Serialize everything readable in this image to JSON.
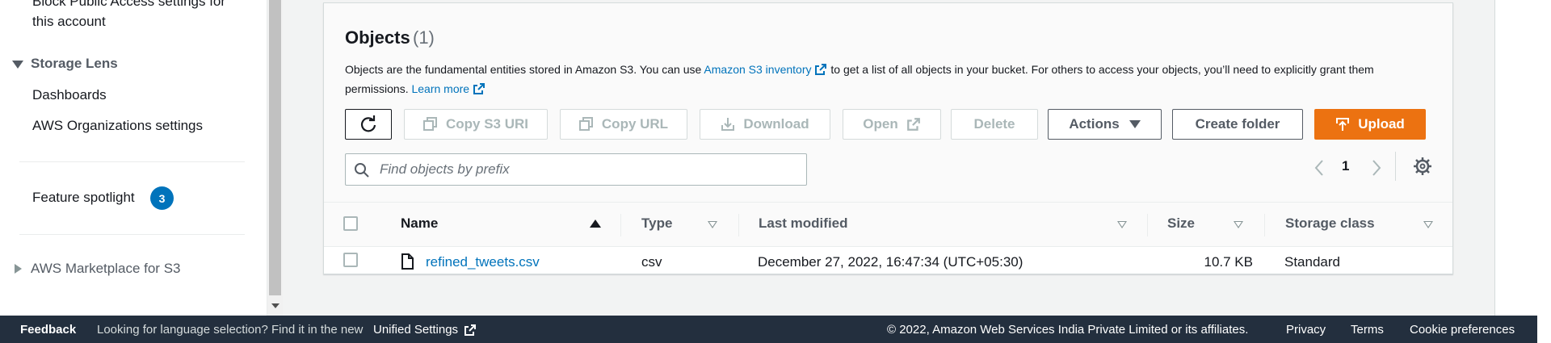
{
  "sidebar": {
    "block_public_access_line1": "Block Public Access settings for",
    "block_public_access_line2": "this account",
    "storage_lens_label": "Storage Lens",
    "dashboards_label": "Dashboards",
    "org_settings_label": "AWS Organizations settings",
    "feature_spotlight_label": "Feature spotlight",
    "feature_spotlight_count": "3",
    "marketplace_label": "AWS Marketplace for S3"
  },
  "objects": {
    "title": "Objects",
    "count": "(1)",
    "desc_part1": "Objects are the fundamental entities stored in Amazon S3. You can use ",
    "inventory_link": "Amazon S3 inventory",
    "desc_part2": " to get a list of all objects in your bucket. For others to access your objects, you’ll need to explicitly grant them permissions. ",
    "learn_more_link": "Learn more"
  },
  "toolbar": {
    "copy_s3_uri": "Copy S3 URI",
    "copy_url": "Copy URL",
    "download": "Download",
    "open": "Open",
    "delete": "Delete",
    "actions": "Actions",
    "create_folder": "Create folder",
    "upload": "Upload"
  },
  "search": {
    "placeholder": "Find objects by prefix",
    "value": ""
  },
  "pagination": {
    "current_page": "1"
  },
  "table": {
    "headers": {
      "name": "Name",
      "type": "Type",
      "last_modified": "Last modified",
      "size": "Size",
      "storage_class": "Storage class"
    },
    "rows": [
      {
        "name": "refined_tweets.csv",
        "type": "csv",
        "last_modified": "December 27, 2022, 16:47:34 (UTC+05:30)",
        "size": "10.7 KB",
        "storage_class": "Standard"
      }
    ]
  },
  "footer": {
    "feedback": "Feedback",
    "language_text": "Looking for language selection? Find it in the new ",
    "unified_settings": "Unified Settings",
    "copyright": "© 2022, Amazon Web Services India Private Limited or its affiliates.",
    "privacy": "Privacy",
    "terms": "Terms",
    "cookie_preferences": "Cookie preferences"
  },
  "colors": {
    "accent": "#0073bb",
    "upload": "#ec7211",
    "footer_bg": "#232f3e"
  }
}
